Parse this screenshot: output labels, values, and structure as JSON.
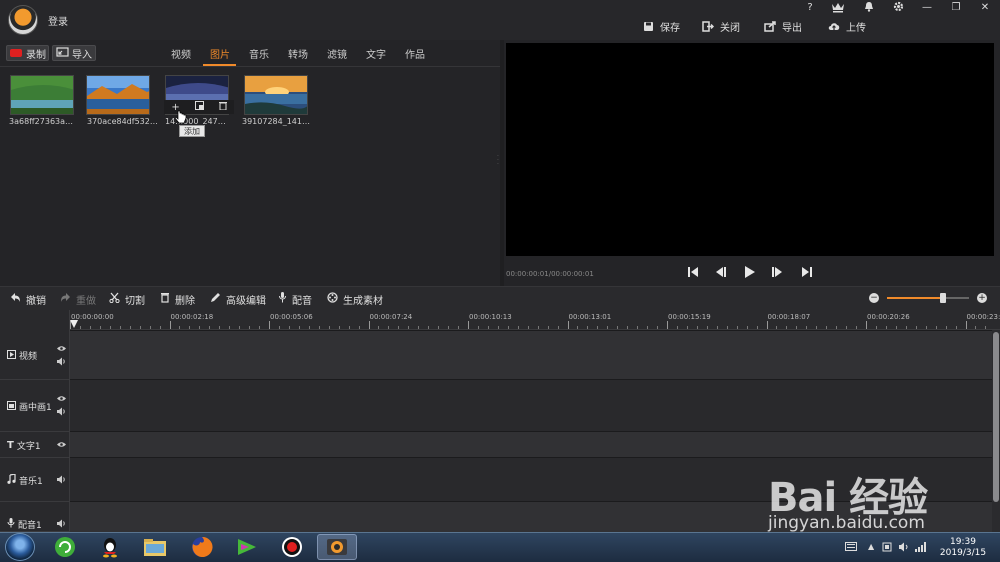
{
  "titlebar": {
    "login": "登录",
    "win_controls": [
      "?",
      "VIP",
      "bell-icon",
      "gear-icon",
      "—",
      "❐",
      "✕"
    ],
    "actions": [
      {
        "label": "保存",
        "icon": "save-icon"
      },
      {
        "label": "关闭",
        "icon": "close-project-icon"
      },
      {
        "label": "导出",
        "icon": "export-icon"
      },
      {
        "label": "上传",
        "icon": "upload-icon"
      }
    ]
  },
  "media": {
    "record_label": "录制",
    "import_label": "导入",
    "tabs": [
      "视频",
      "图片",
      "音乐",
      "转场",
      "滤镜",
      "文字",
      "作品"
    ],
    "active_tab": "图片",
    "items": [
      {
        "label": "3a68ff27363a…",
        "scene": "green-lake"
      },
      {
        "label": "370ace84df532…",
        "scene": "autumn-lake"
      },
      {
        "label": "14…000_247…",
        "scene": "night-sky"
      },
      {
        "label": "39107284_141…",
        "scene": "sunset-sea"
      }
    ],
    "tooltip": "添加"
  },
  "preview": {
    "time": "00:00:00:01/00:00:00:01"
  },
  "edit_toolbar": {
    "tools": [
      {
        "label": "撤销",
        "icon": "undo-icon",
        "disabled": false
      },
      {
        "label": "重做",
        "icon": "redo-icon",
        "disabled": true
      },
      {
        "label": "切割",
        "icon": "scissors-icon",
        "disabled": false
      },
      {
        "label": "删除",
        "icon": "trash-icon",
        "disabled": false
      },
      {
        "label": "高级编辑",
        "icon": "pencil-icon",
        "disabled": false
      },
      {
        "label": "配音",
        "icon": "microphone-icon",
        "disabled": false
      },
      {
        "label": "生成素材",
        "icon": "film-reel-icon",
        "disabled": false
      }
    ],
    "zoom_level": 0.68
  },
  "timeline": {
    "ruler_labels": [
      "00:00:00:00",
      "00:00:02:18",
      "00:00:05:06",
      "00:00:07:24",
      "00:00:10:13",
      "00:00:13:01",
      "00:00:15:19",
      "00:00:18:07",
      "00:00:20:26",
      "00:00:23:"
    ],
    "tracks": [
      {
        "label": "视频",
        "icon": "video-icon"
      },
      {
        "label": "画中画1",
        "icon": "pip-icon"
      },
      {
        "label": "文字1",
        "icon": "text-icon"
      },
      {
        "label": "音乐1",
        "icon": "music-icon"
      },
      {
        "label": "配音1",
        "icon": "microphone-icon"
      }
    ]
  },
  "taskbar": {
    "time": "19:39",
    "date": "2019/3/15"
  },
  "watermark": {
    "brand": "Bai 经验",
    "url": "jingyan.baidu.com"
  },
  "colors": {
    "accent": "#f08a2a",
    "record": "#e02020"
  }
}
